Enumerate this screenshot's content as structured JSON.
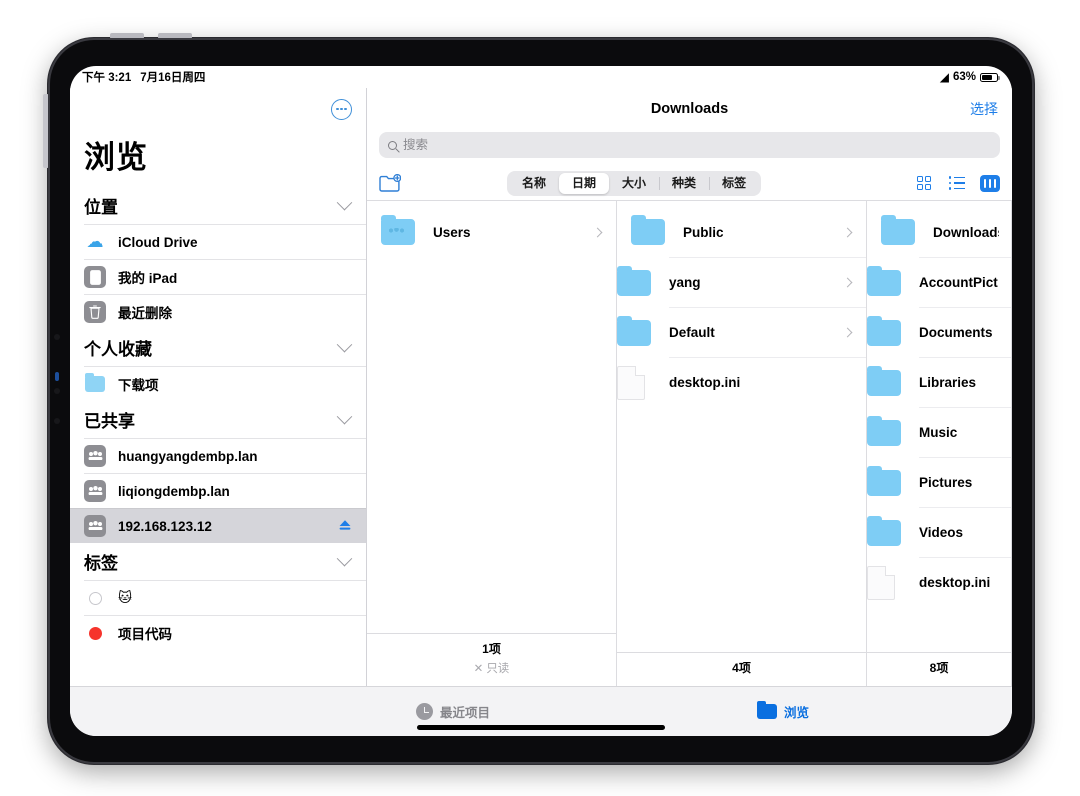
{
  "status_bar": {
    "time": "下午 3:21",
    "date": "7月16日周四",
    "wifi_icon": "wifi-icon",
    "battery_percent": "63%",
    "battery_level": 63
  },
  "sidebar": {
    "title": "浏览",
    "more_button_icon": "ellipsis-circle-icon",
    "sections": [
      {
        "name": "locations",
        "header": "位置",
        "collapse_icon": "chevron-down-icon",
        "items": [
          {
            "label": "iCloud Drive",
            "icon": "icloud-drive-icon",
            "selected": false
          },
          {
            "label": "我的 iPad",
            "icon": "ipad-icon",
            "selected": false
          },
          {
            "label": "最近删除",
            "icon": "trash-icon",
            "selected": false
          }
        ]
      },
      {
        "name": "favorites",
        "header": "个人收藏",
        "collapse_icon": "chevron-down-icon",
        "items": [
          {
            "label": "下载项",
            "icon": "downloads-folder-icon",
            "selected": false
          }
        ]
      },
      {
        "name": "shared",
        "header": "已共享",
        "collapse_icon": "chevron-down-icon",
        "items": [
          {
            "label": "huangyangdembp.lan",
            "icon": "server-icon",
            "selected": false
          },
          {
            "label": "liqiongdembp.lan",
            "icon": "server-icon",
            "selected": false
          },
          {
            "label": "192.168.123.12",
            "icon": "server-icon",
            "selected": true,
            "eject_icon": "eject-icon"
          }
        ]
      },
      {
        "name": "tags",
        "header": "标签",
        "collapse_icon": "chevron-down-icon",
        "items": [
          {
            "label": "🐱",
            "icon": "tag-dot-none",
            "color": "#ffffff",
            "selected": false
          },
          {
            "label": "项目代码",
            "icon": "tag-dot-red",
            "color": "#f6342c",
            "selected": false
          }
        ]
      }
    ]
  },
  "nav": {
    "title": "Downloads",
    "select_label": "选择"
  },
  "search": {
    "placeholder": "搜索",
    "value": "",
    "icon": "search-icon"
  },
  "toolbar": {
    "new_folder_icon": "new-folder-icon",
    "sort_options": [
      {
        "label": "名称",
        "active": false
      },
      {
        "label": "日期",
        "active": true
      },
      {
        "label": "大小",
        "active": false
      },
      {
        "label": "种类",
        "active": false
      },
      {
        "label": "标签",
        "active": false
      }
    ],
    "view_modes": [
      {
        "name": "grid-view-icon",
        "active": false
      },
      {
        "name": "list-view-icon",
        "active": false
      },
      {
        "name": "column-view-icon",
        "active": true
      }
    ]
  },
  "columns": [
    {
      "name": "column-1",
      "items": [
        {
          "label": "Users",
          "type": "folder",
          "shared": true,
          "chevron": true
        }
      ],
      "footer": {
        "count": "1项",
        "note": "只读",
        "note_icon": "no-write-icon"
      }
    },
    {
      "name": "column-2",
      "items": [
        {
          "label": "Public",
          "type": "folder",
          "shared": false,
          "chevron": true
        },
        {
          "label": "yang",
          "type": "folder",
          "shared": false,
          "chevron": true
        },
        {
          "label": "Default",
          "type": "folder",
          "shared": false,
          "chevron": true
        },
        {
          "label": "desktop.ini",
          "type": "file",
          "shared": false,
          "chevron": false
        }
      ],
      "footer": {
        "count": "4项",
        "note": "",
        "note_icon": ""
      }
    },
    {
      "name": "column-3",
      "items": [
        {
          "label": "Downloads",
          "type": "folder",
          "shared": false,
          "chevron": false
        },
        {
          "label": "AccountPict",
          "type": "folder",
          "shared": false,
          "chevron": false
        },
        {
          "label": "Documents",
          "type": "folder",
          "shared": false,
          "chevron": false
        },
        {
          "label": "Libraries",
          "type": "folder",
          "shared": false,
          "chevron": false
        },
        {
          "label": "Music",
          "type": "folder",
          "shared": false,
          "chevron": false
        },
        {
          "label": "Pictures",
          "type": "folder",
          "shared": false,
          "chevron": false
        },
        {
          "label": "Videos",
          "type": "folder",
          "shared": false,
          "chevron": false
        },
        {
          "label": "desktop.ini",
          "type": "file",
          "shared": false,
          "chevron": false
        }
      ],
      "footer": {
        "count": "8项",
        "note": "",
        "note_icon": ""
      }
    }
  ],
  "tab_bar": {
    "tabs": [
      {
        "label": "最近项目",
        "icon": "recents-clock-icon",
        "active": false
      },
      {
        "label": "浏览",
        "icon": "browse-folder-icon",
        "active": true
      }
    ]
  },
  "colors": {
    "accent": "#1e7ee8",
    "folder_blue": "#7ecdf5",
    "selected_row": "#d5d5da",
    "tag_red": "#f6342c"
  }
}
